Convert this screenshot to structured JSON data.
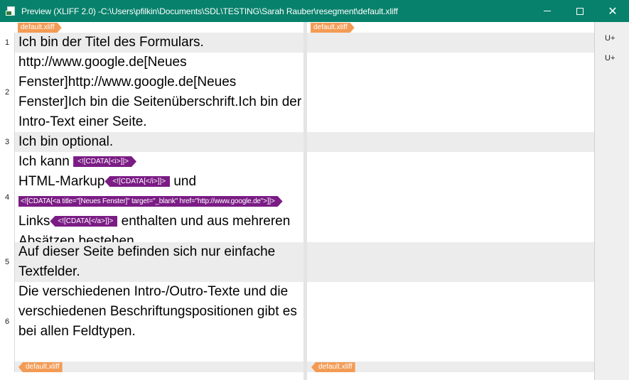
{
  "window": {
    "title": "Preview (XLIFF 2.0) -C:\\Users\\pfilkin\\Documents\\SDL\\TESTING\\Sarah Rauber\\resegment\\default.xliff",
    "controls": {
      "minimize": "minimize",
      "maximize": "maximize",
      "close": "✕"
    }
  },
  "file_tags": {
    "source_open": "default.xliff",
    "target_open": "default.xliff",
    "source_close": "default.xliff",
    "target_close": "default.xliff"
  },
  "side_panel": {
    "markers": [
      "U+",
      "U+"
    ]
  },
  "segments": [
    {
      "num": "1",
      "text": "Ich bin der Titel des Formulars."
    },
    {
      "num": "2",
      "text": "http://www.google.de[Neues Fenster]http://www.google.de[Neues Fenster]Ich bin die Seitenüberschrift.Ich bin der Intro-Text einer Seite."
    },
    {
      "num": "3",
      "text": "Ich bin optional."
    },
    {
      "num": "4",
      "parts": {
        "t1": "Ich kann ",
        "tag1": "<![CDATA[<i>]]>",
        "t2": "HTML-Markup",
        "tag2": "<![CDATA[</i>]]>",
        "t3": " und ",
        "tag3": "<![CDATA[<a title=\"[Neues Fenster]\" target=\"_blank\" href=\"http://www.google.de\">]]>",
        "t4": "Links",
        "tag4": "<![CDATA[</a>]]>",
        "t5": " enthalten und aus mehreren Absätzen bestehen."
      }
    },
    {
      "num": "5",
      "text": "Auf dieser Seite befinden sich nur einfache Textfelder."
    },
    {
      "num": "6",
      "text": "Die verschiedenen Intro-/Outro-Texte und die verschiedenen Beschriftungspositionen gibt es bei allen Feldtypen."
    }
  ],
  "colors": {
    "titlebar": "#07816b",
    "file_tag": "#f39b55",
    "inline_tag": "#7b1c85",
    "shaded_row": "#ececec"
  }
}
